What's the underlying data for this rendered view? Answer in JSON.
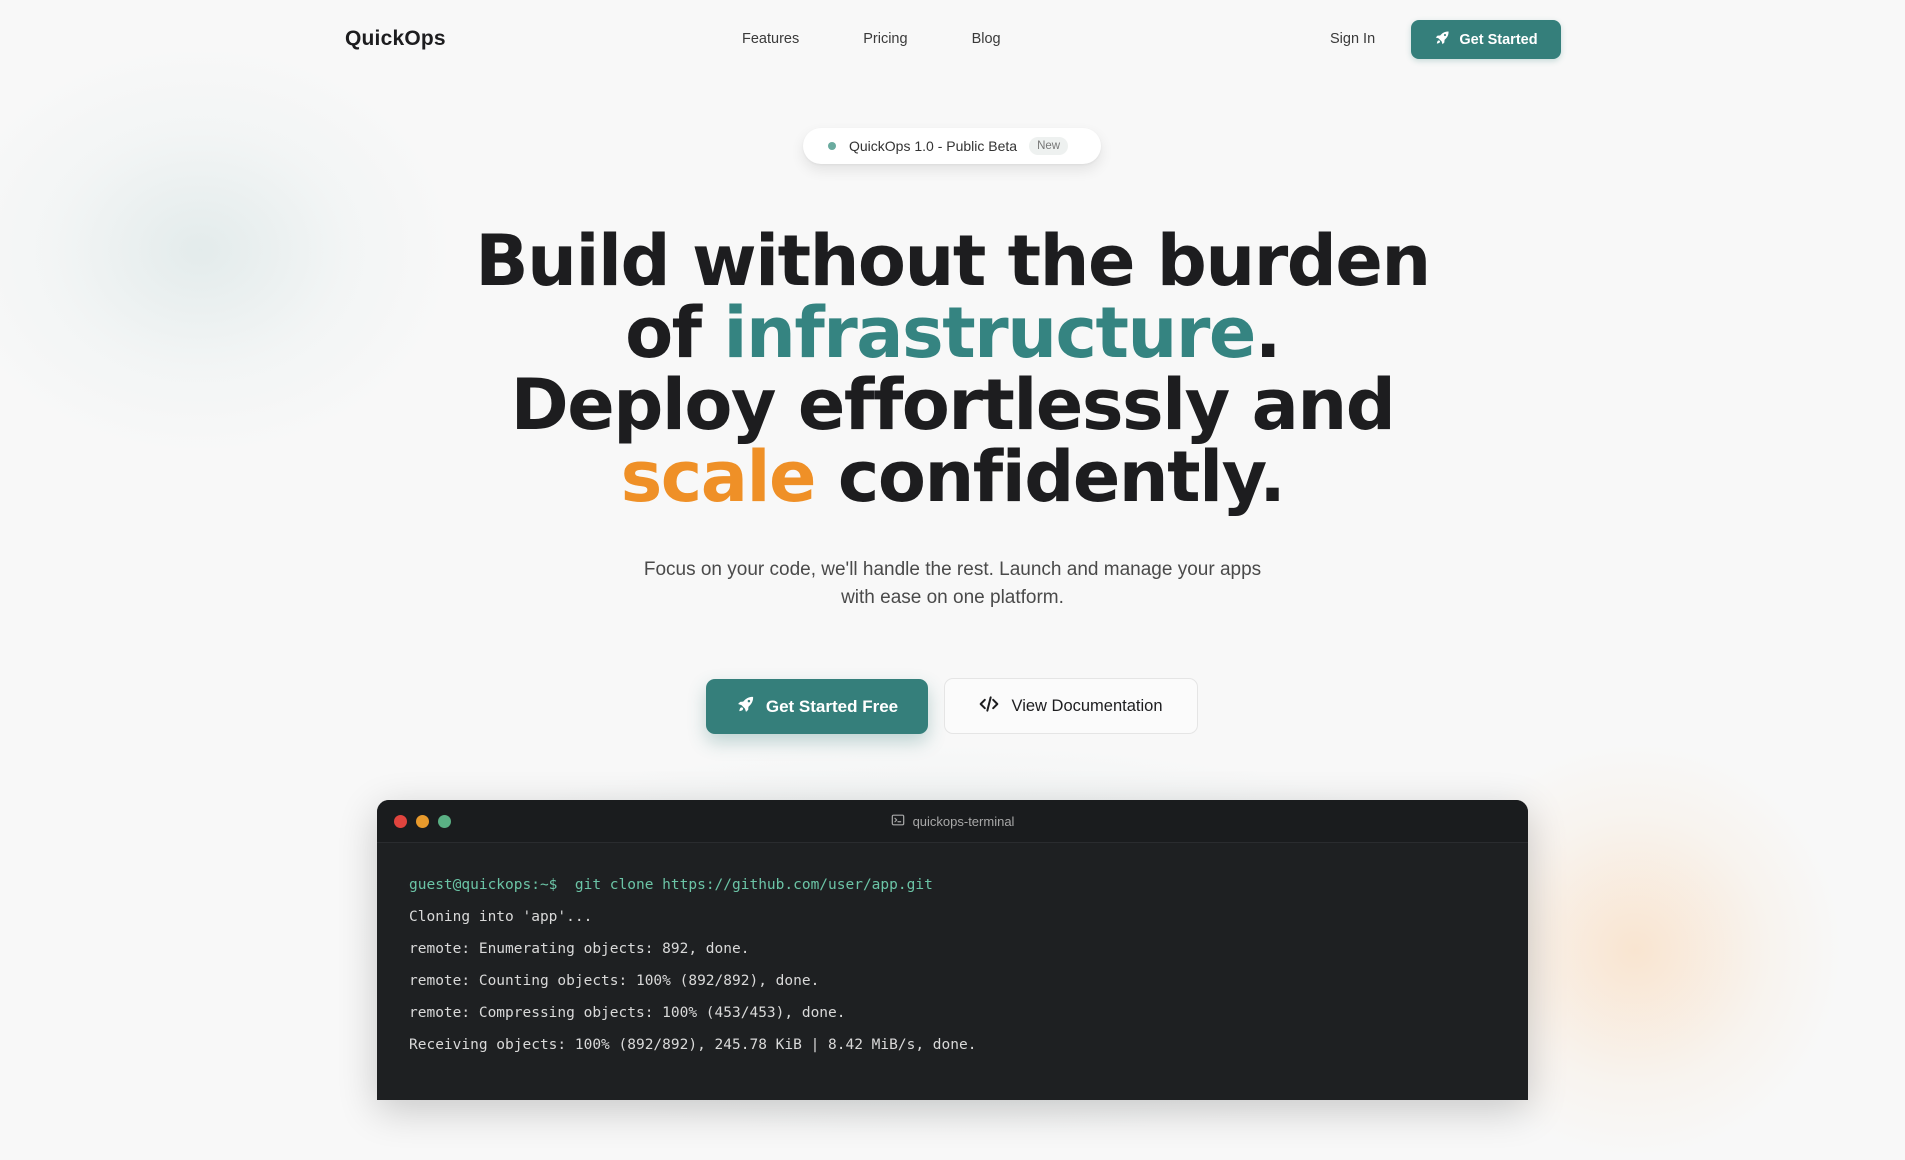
{
  "nav": {
    "logo": "QuickOps",
    "links": [
      "Features",
      "Pricing",
      "Blog"
    ],
    "sign_in": "Sign In",
    "cta": "Get Started",
    "cta_icon": "rocket-icon"
  },
  "badge": {
    "text": "QuickOps 1.0 - Public Beta",
    "tag": "New"
  },
  "hero": {
    "line1": "Build without the burden",
    "line2_prefix": "of ",
    "line2_highlight": "infrastructure",
    "line2_suffix": ".",
    "line3": "Deploy effortlessly and",
    "line4_highlight": "scale",
    "line4_suffix": " confidently.",
    "subtitle_line1": "Focus on your code, we'll handle the rest. Launch and manage your apps",
    "subtitle_line2": "with ease on one platform."
  },
  "buttons": {
    "primary": "Get Started Free",
    "primary_icon": "rocket-icon",
    "secondary": "View Documentation",
    "secondary_icon": "code-icon"
  },
  "terminal": {
    "title": "quickops-terminal",
    "prompt": "guest@quickops:~$",
    "command": "git clone https://github.com/user/app.git",
    "output": [
      "Cloning into 'app'...",
      "remote: Enumerating objects: 892, done.",
      "remote: Counting objects: 100% (892/892), done.",
      "remote: Compressing objects: 100% (453/453), done.",
      "Receiving objects: 100% (892/892), 245.78 KiB | 8.42 MiB/s, done."
    ]
  },
  "colors": {
    "accent_teal": "#357f7b",
    "highlight_orange": "#ef9027",
    "terminal_bg": "#1e2022",
    "prompt_green": "#6bc4a6"
  }
}
